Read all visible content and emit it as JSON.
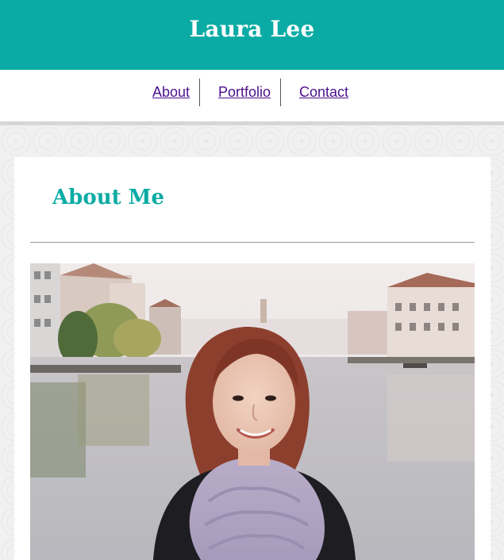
{
  "header": {
    "title": "Laura Lee",
    "background_color": "#0aaba4"
  },
  "nav": {
    "items": [
      {
        "label": "About"
      },
      {
        "label": "Portfolio"
      },
      {
        "label": "Contact"
      }
    ],
    "link_color": "#4b0f8c"
  },
  "main": {
    "heading": "About Me",
    "heading_color": "#0aaba4",
    "photo_description": "portrait-photo"
  }
}
